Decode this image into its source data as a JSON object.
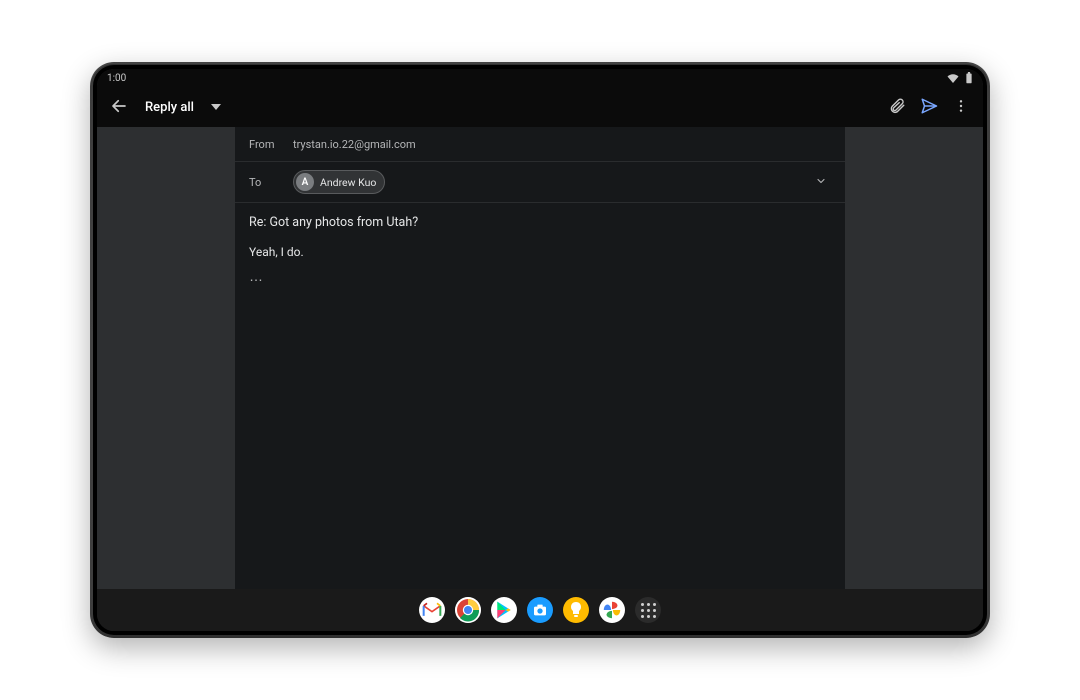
{
  "status": {
    "time": "1:00"
  },
  "appbar": {
    "title": "Reply all"
  },
  "compose": {
    "from_label": "From",
    "from_email": "trystan.io.22@gmail.com",
    "to_label": "To",
    "recipient": {
      "name": "Andrew Kuo",
      "initial": "A"
    },
    "subject": "Re: Got any photos from Utah?",
    "body": "Yeah, I do.",
    "quoted_trigger": "…"
  },
  "taskbar": {
    "apps": [
      "gmail",
      "chrome",
      "play-store",
      "camera",
      "keep",
      "photos"
    ]
  }
}
